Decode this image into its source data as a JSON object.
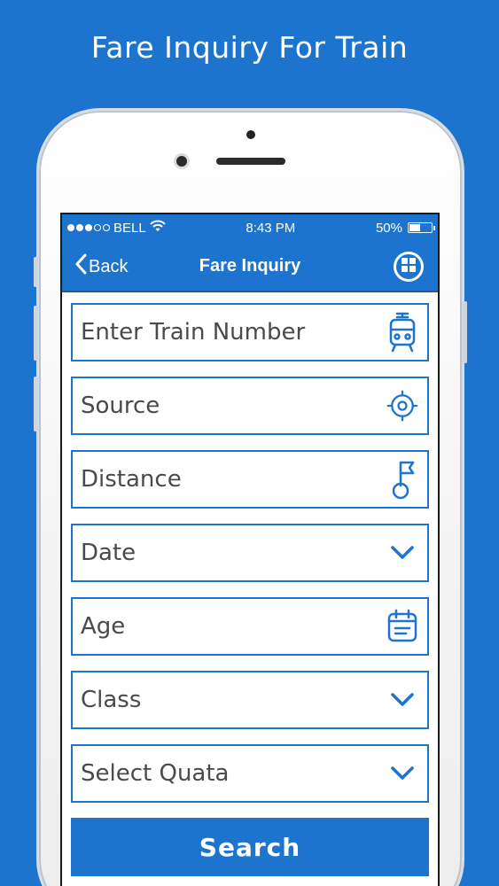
{
  "headline": "Fare Inquiry For Train",
  "status_bar": {
    "carrier": "BELL",
    "time": "8:43 PM",
    "battery": "50%",
    "battery_level": 0.5,
    "signal_bars_filled": 3,
    "signal_bars_total": 5
  },
  "nav": {
    "back_label": "Back",
    "title": "Fare Inquiry",
    "menu_icon": "grid-menu-icon"
  },
  "form": {
    "fields": [
      {
        "placeholder": "Enter Train Number",
        "icon": "train-icon"
      },
      {
        "placeholder": "Source",
        "icon": "location-target-icon"
      },
      {
        "placeholder": "Distance",
        "icon": "flag-icon"
      },
      {
        "placeholder": "Date",
        "icon": "chevron-down-icon"
      },
      {
        "placeholder": "Age",
        "icon": "calendar-icon"
      },
      {
        "placeholder": "Class",
        "icon": "chevron-down-icon"
      },
      {
        "placeholder": "Select Quata",
        "icon": "chevron-down-icon"
      }
    ],
    "submit_label": "Search"
  },
  "colors": {
    "accent": "#1d74cf",
    "field_text": "#4a4a4a"
  }
}
